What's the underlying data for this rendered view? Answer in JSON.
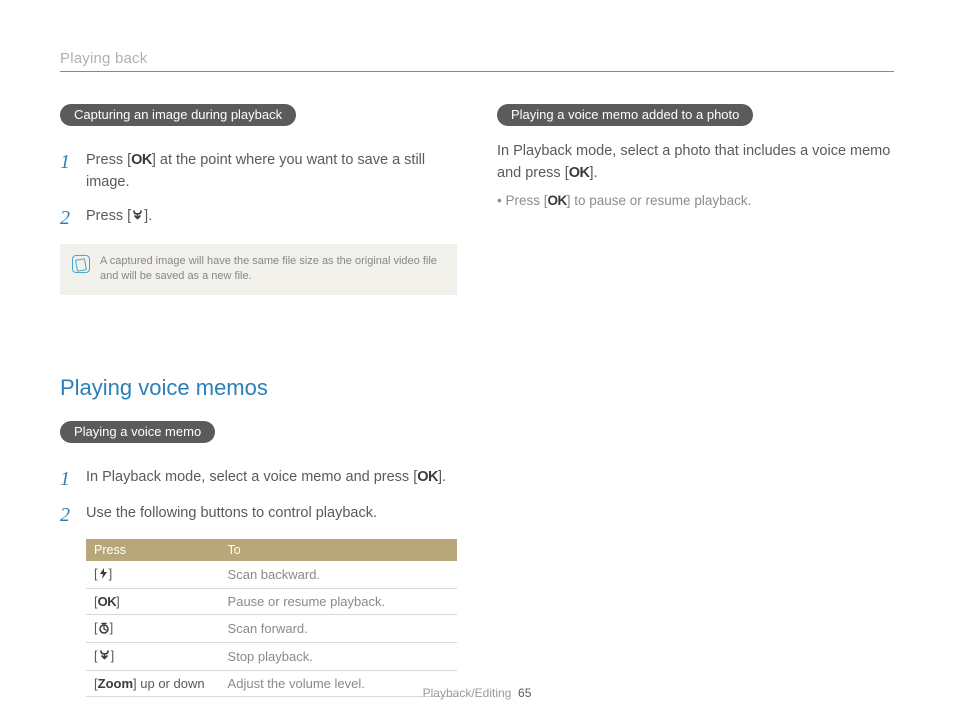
{
  "header": {
    "breadcrumb": "Playing back"
  },
  "left": {
    "pill1": "Capturing an image during playback",
    "step1_a": "Press [",
    "step1_b": "] at the point where you want to save a still image.",
    "step2_a": "Press [",
    "step2_b": "].",
    "note": "A captured image will have the same file size as the original video file and will be saved as a new file.",
    "section_title": "Playing voice memos",
    "pill2": "Playing a voice memo",
    "vm_step1_a": "In Playback mode, select a voice memo and press [",
    "vm_step1_b": "].",
    "vm_step2": "Use the following buttons to control playback.",
    "table": {
      "hdr_press": "Press",
      "hdr_to": "To",
      "rows": [
        {
          "to": "Scan backward."
        },
        {
          "to": "Pause or resume playback."
        },
        {
          "to": "Scan forward."
        },
        {
          "to": "Stop playback."
        },
        {
          "press_extra": " up or down",
          "to": "Adjust the volume level."
        }
      ],
      "zoom_label": "Zoom"
    }
  },
  "right": {
    "pill": "Playing a voice memo added to a photo",
    "body_a": "In Playback mode, select a photo that includes a voice memo and press [",
    "body_b": "].",
    "bullet_a": "Press [",
    "bullet_b": "] to pause or resume playback."
  },
  "icons": {
    "ok": "OK"
  },
  "footer": {
    "section": "Playback/Editing",
    "page": "65"
  }
}
